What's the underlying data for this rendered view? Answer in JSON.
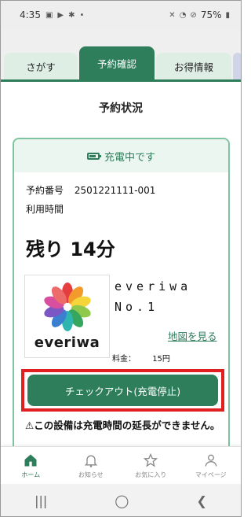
{
  "status_bar": {
    "time": "4:35",
    "battery": "75%"
  },
  "tabs": [
    {
      "label": "さがす"
    },
    {
      "label": "予約確認"
    },
    {
      "label": "お得情報"
    }
  ],
  "page_title": "予約状況",
  "card": {
    "status": "充電中です",
    "reservation_label": "予約番号",
    "reservation_number": "2501221111-001",
    "usage_time_label": "利用時間",
    "remaining": "残り 14分",
    "logo_text": "everiwa",
    "facility_line1": "everiwa",
    "facility_line2": "No.1",
    "map_link": "地図を見る",
    "fee_label": "料金：",
    "fee_value": "15円",
    "checkout_button": "チェックアウト(充電停止)",
    "warning": "⚠この設備は充電時間の延長ができません。"
  },
  "bottom_nav": [
    {
      "label": "ホーム",
      "icon": "home-icon"
    },
    {
      "label": "お知らせ",
      "icon": "bell-icon"
    },
    {
      "label": "お気に入り",
      "icon": "star-icon"
    },
    {
      "label": "マイページ",
      "icon": "person-icon"
    }
  ],
  "colors": {
    "accent": "#2e7d5b",
    "highlight_border": "#e02020"
  }
}
